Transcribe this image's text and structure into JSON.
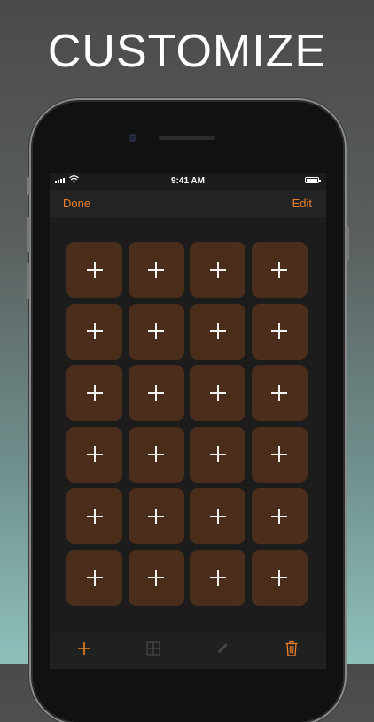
{
  "headline": "CUSTOMIZE",
  "status_bar": {
    "time": "9:41 AM"
  },
  "nav": {
    "left_label": "Done",
    "right_label": "Edit"
  },
  "grid": {
    "rows": 6,
    "columns": 4,
    "tile_icon": "plus-icon"
  },
  "toolbar": {
    "items": [
      {
        "icon": "add-icon",
        "enabled": true
      },
      {
        "icon": "layout-grid-icon",
        "enabled": false
      },
      {
        "icon": "pencil-icon",
        "enabled": false
      },
      {
        "icon": "trash-icon",
        "enabled": true
      }
    ]
  },
  "colors": {
    "accent": "#e8822a",
    "tile": "#4a2d1a",
    "screen_background": "#1c1c1c"
  }
}
